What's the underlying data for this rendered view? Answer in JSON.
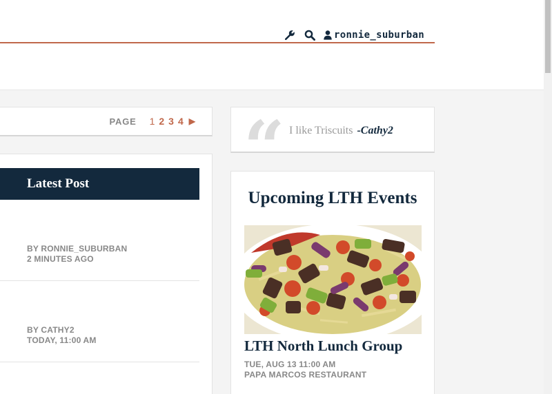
{
  "header": {
    "username": "ronnie_suburban",
    "icons": [
      "wrench-icon",
      "search-icon",
      "user-icon"
    ],
    "accent_color": "#c0674a"
  },
  "pager": {
    "label": "PAGE",
    "pages": [
      "1",
      "2",
      "3",
      "4"
    ],
    "current": "1",
    "next_symbol": "▶"
  },
  "quote": {
    "text": "I like Triscuits",
    "author": "-Cathy2"
  },
  "feed": {
    "heading": "Latest Post",
    "posts": [
      {
        "by": "BY RONNIE_SUBURBAN",
        "when": "2 MINUTES AGO"
      },
      {
        "by": "BY CATHY2",
        "when": "TODAY, 11:00 AM"
      }
    ]
  },
  "events": {
    "heading": "Upcoming LTH Events",
    "items": [
      {
        "name": "LTH North Lunch Group",
        "datetime": "TUE, AUG 13 11:00 AM",
        "place": "PAPA MARCOS RESTAURANT"
      }
    ]
  },
  "colors": {
    "navy": "#13293d",
    "muted": "#888888",
    "background": "#f4f4f4"
  }
}
